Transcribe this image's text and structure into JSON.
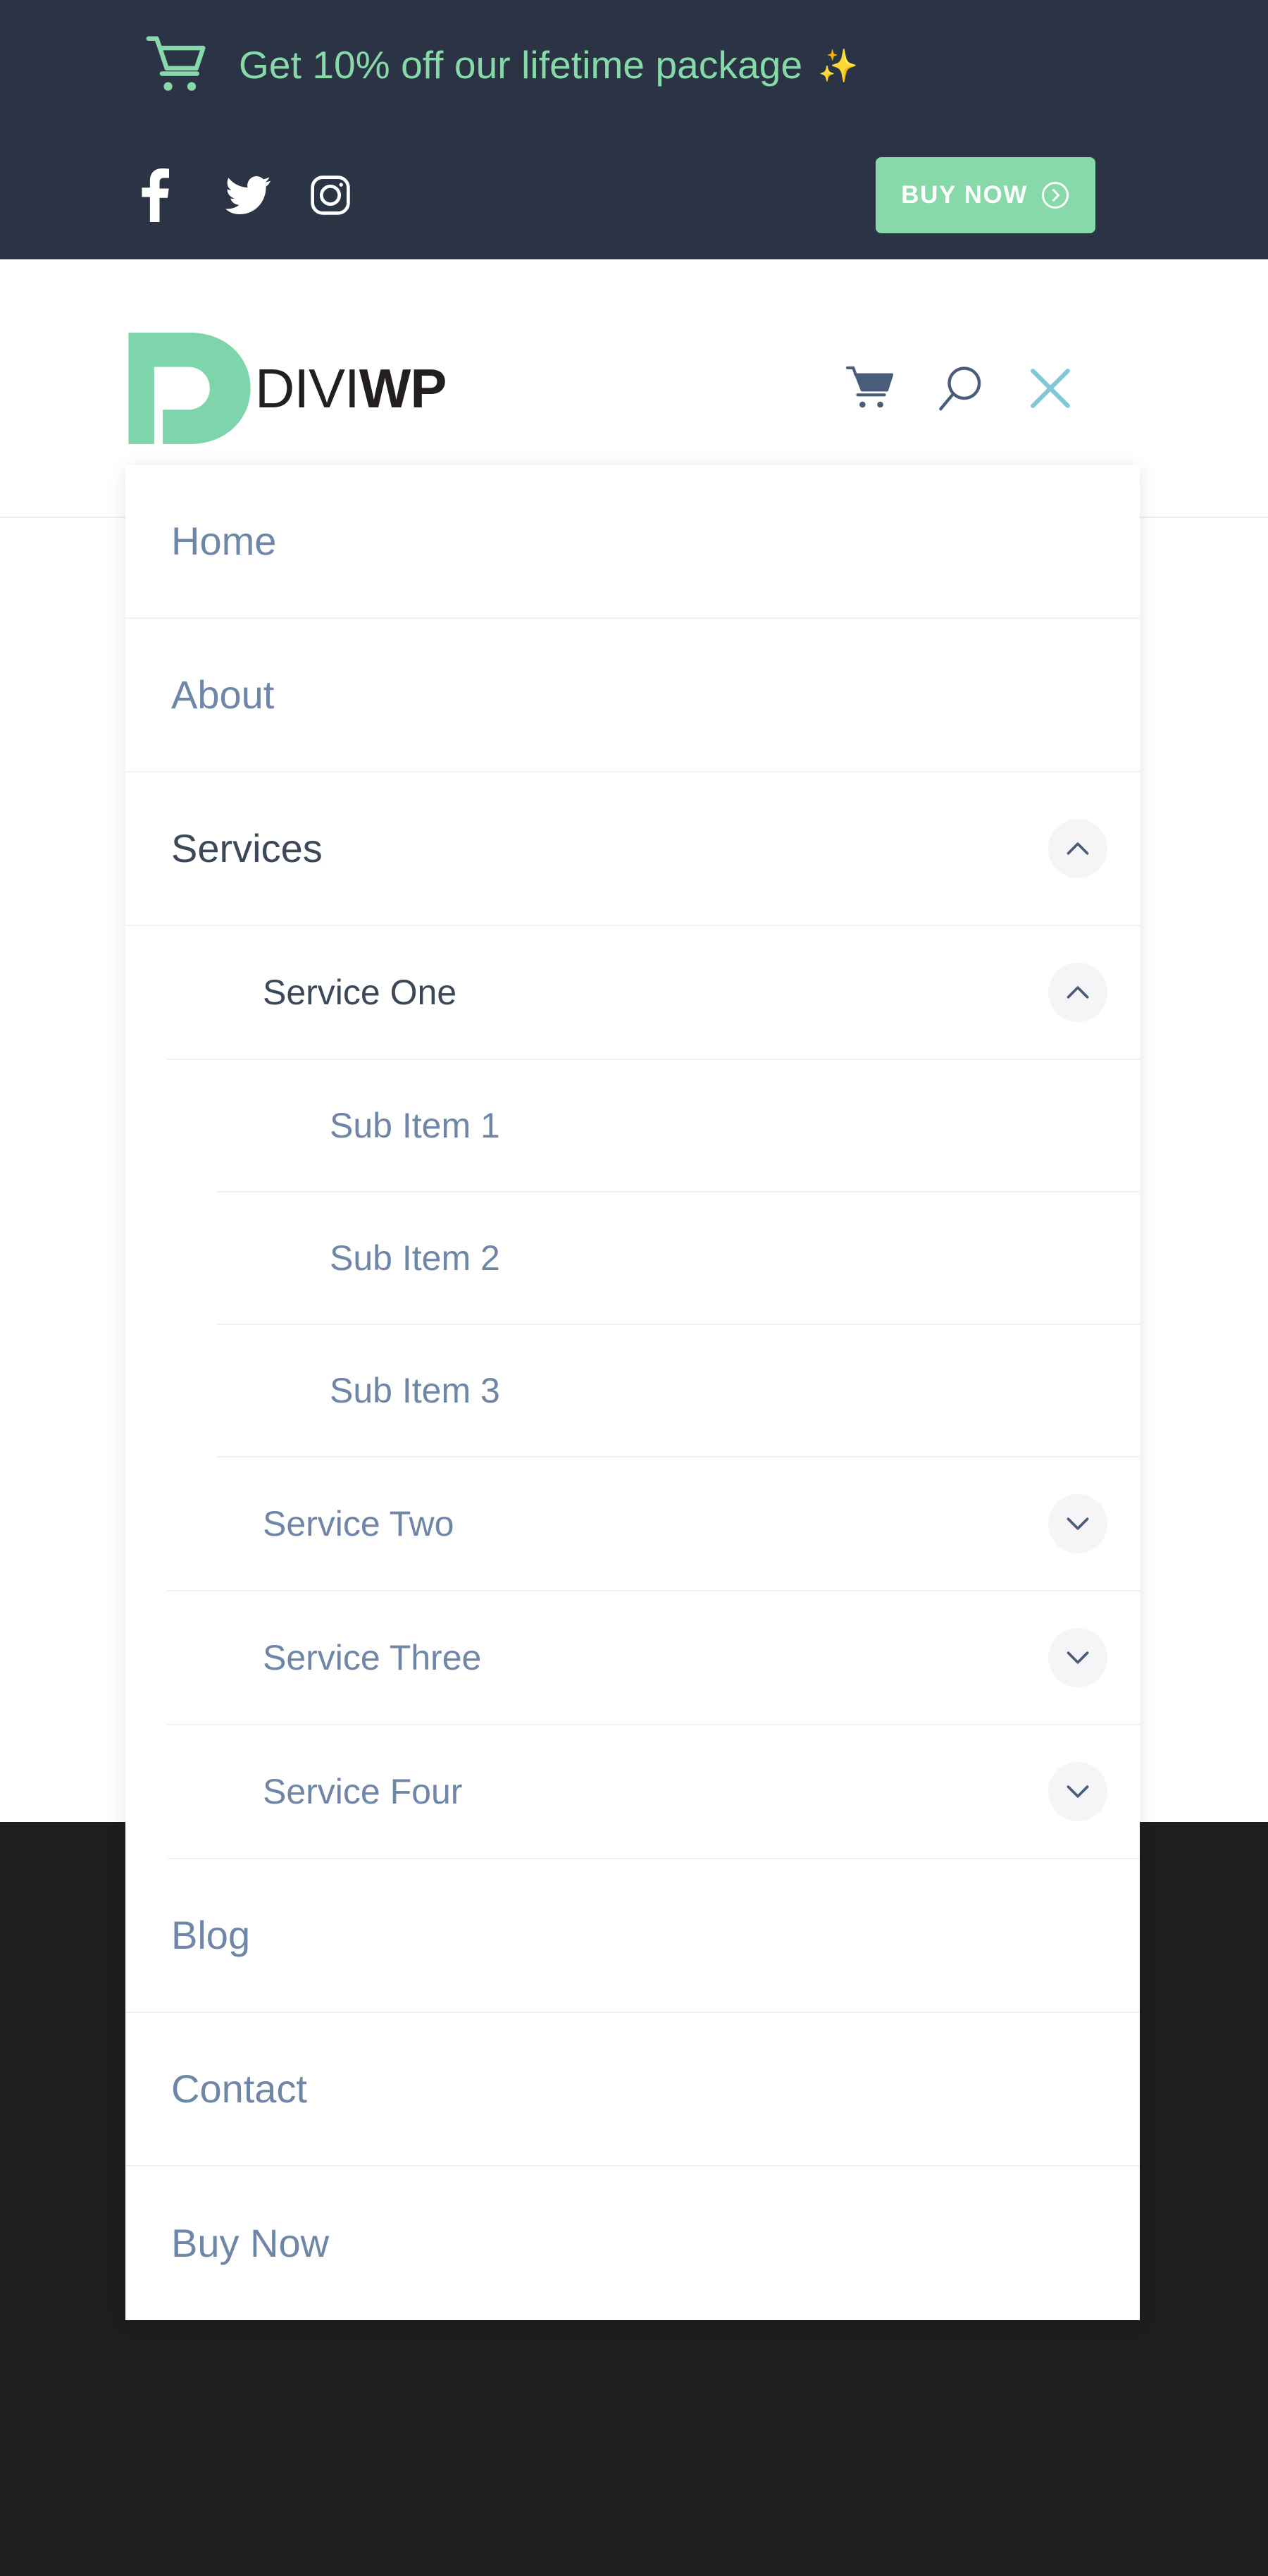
{
  "colors": {
    "topbar_bg": "#2b3445",
    "accent_green": "#87d9aa",
    "dark_section": "#1e1e1e",
    "menu_text": "#6f86a6",
    "menu_text_active": "#3c4858",
    "close_icon": "#7fc8d8",
    "divider": "#f1f1f3",
    "toggle_bg": "#f5f5f7",
    "logo_dark": "#231f20"
  },
  "topbar": {
    "cart_icon": "shopping-cart-icon",
    "promo_text": "Get 10% off our lifetime package",
    "sparkle": "✨",
    "socials": [
      {
        "name": "facebook",
        "icon": "facebook-icon"
      },
      {
        "name": "twitter",
        "icon": "twitter-icon"
      },
      {
        "name": "instagram",
        "icon": "instagram-icon"
      }
    ],
    "buy_now_label": "BUY NOW",
    "buy_now_icon": "arrow-right-circle-icon"
  },
  "header": {
    "logo": {
      "mark": "divi-d-logo-mark",
      "text_light": "DIVI",
      "text_bold": "WP"
    },
    "icons": [
      {
        "name": "cart-icon",
        "label": "Cart"
      },
      {
        "name": "search-icon",
        "label": "Search"
      },
      {
        "name": "close-icon",
        "label": "Close menu"
      }
    ]
  },
  "menu": {
    "items": [
      {
        "level": 1,
        "label": "Home",
        "has_toggle": false,
        "expanded": false,
        "active": false
      },
      {
        "level": 1,
        "label": "About",
        "has_toggle": false,
        "expanded": false,
        "active": false
      },
      {
        "level": 1,
        "label": "Services",
        "has_toggle": true,
        "expanded": true,
        "active": true,
        "toggle_icon": "chevron-up-icon"
      },
      {
        "level": 2,
        "label": "Service One",
        "has_toggle": true,
        "expanded": true,
        "active": true,
        "toggle_icon": "chevron-up-icon"
      },
      {
        "level": 3,
        "label": "Sub Item 1",
        "has_toggle": false,
        "expanded": false,
        "active": false
      },
      {
        "level": 3,
        "label": "Sub Item 2",
        "has_toggle": false,
        "expanded": false,
        "active": false
      },
      {
        "level": 3,
        "label": "Sub Item 3",
        "has_toggle": false,
        "expanded": false,
        "active": false
      },
      {
        "level": 2,
        "label": "Service Two",
        "has_toggle": true,
        "expanded": false,
        "active": false,
        "toggle_icon": "chevron-down-icon"
      },
      {
        "level": 2,
        "label": "Service Three",
        "has_toggle": true,
        "expanded": false,
        "active": false,
        "toggle_icon": "chevron-down-icon"
      },
      {
        "level": 2,
        "label": "Service Four",
        "has_toggle": true,
        "expanded": false,
        "active": false,
        "toggle_icon": "chevron-down-icon"
      },
      {
        "level": 1,
        "label": "Blog",
        "has_toggle": false,
        "expanded": false,
        "active": false
      },
      {
        "level": 1,
        "label": "Contact",
        "has_toggle": false,
        "expanded": false,
        "active": false
      },
      {
        "level": 1,
        "label": "Buy Now",
        "has_toggle": false,
        "expanded": false,
        "active": false
      }
    ]
  }
}
